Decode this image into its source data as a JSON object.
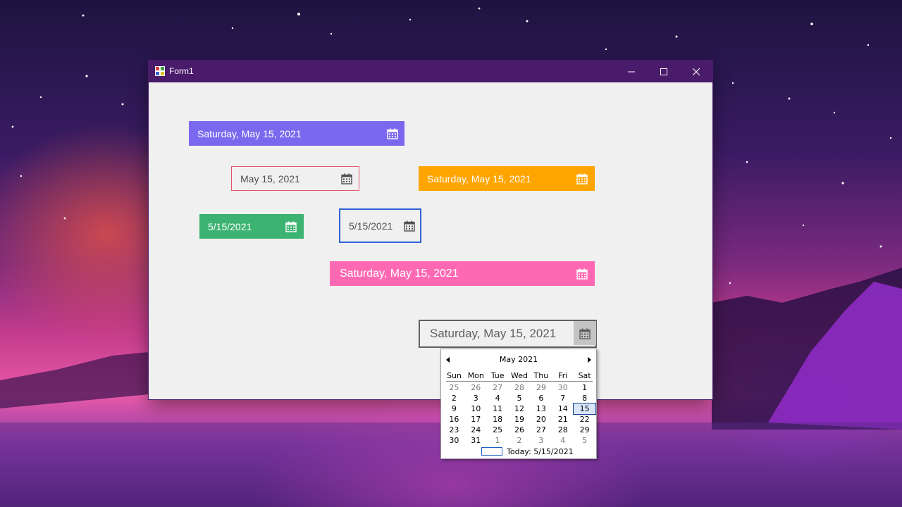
{
  "window": {
    "title": "Form1"
  },
  "pickers": [
    {
      "value": "Saturday, May 15, 2021",
      "bg": "#7b68ee",
      "fg": "#ffffff"
    },
    {
      "value": "May 15, 2021",
      "bg": "#f0f0f0",
      "fg": "#505050",
      "border": "#e0556e"
    },
    {
      "value": "Saturday, May 15, 2021",
      "bg": "#ffa500",
      "fg": "#ffffff"
    },
    {
      "value": "5/15/2021",
      "bg": "#3cb371",
      "fg": "#ffffff"
    },
    {
      "value": "5/15/2021",
      "bg": "#f0f0f0",
      "fg": "#505050",
      "border": "#2f63d6"
    },
    {
      "value": "Saturday, May 15, 2021",
      "bg": "#ff69b4",
      "fg": "#ffffff"
    },
    {
      "value": "Saturday, May 15, 2021",
      "bg": "#f0f0f0",
      "fg": "#606060",
      "border": "#606060"
    }
  ],
  "calendar": {
    "month": "May 2021",
    "days": [
      "Sun",
      "Mon",
      "Tue",
      "Wed",
      "Thu",
      "Fri",
      "Sat"
    ],
    "weeks": [
      [
        "25",
        "26",
        "27",
        "28",
        "29",
        "30",
        "1"
      ],
      [
        "2",
        "3",
        "4",
        "5",
        "6",
        "7",
        "8"
      ],
      [
        "9",
        "10",
        "11",
        "12",
        "13",
        "14",
        "15"
      ],
      [
        "16",
        "17",
        "18",
        "19",
        "20",
        "21",
        "22"
      ],
      [
        "23",
        "24",
        "25",
        "26",
        "27",
        "28",
        "29"
      ],
      [
        "30",
        "31",
        "1",
        "2",
        "3",
        "4",
        "5"
      ]
    ],
    "selected": "15",
    "today": "Today: 5/15/2021"
  }
}
